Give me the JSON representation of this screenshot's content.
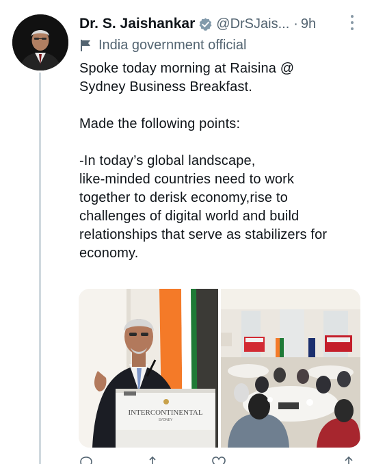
{
  "tweet": {
    "author_name": "Dr. S. Jaishankar",
    "handle": "@DrSJais...",
    "separator": "·",
    "time": "9h",
    "account_label": "India government official",
    "text_lines": [
      "Spoke today morning at Raisina @",
      "Sydney Business Breakfast.",
      "",
      "Made the following points:",
      "",
      "-In today’s global landscape,",
      "like-minded countries need to work",
      "together to derisk economy,rise to",
      "challenges of digital world and build",
      "relationships that serve as stabilizers for",
      "economy."
    ],
    "podium_brand": "INTERCONTINENTAL",
    "podium_city": "SYDNEY"
  },
  "icons": {
    "verified": "verified-badge-icon",
    "more": "more-options-icon",
    "label": "government-flag-icon"
  },
  "colors": {
    "name_text": "#0f1419",
    "secondary_text": "#536471",
    "verified_badge": "#829aab",
    "thread_line": "#cfd9de",
    "flag_saffron": "#f47a28",
    "flag_green": "#1f7a36",
    "screen_red": "#c41e2a"
  }
}
